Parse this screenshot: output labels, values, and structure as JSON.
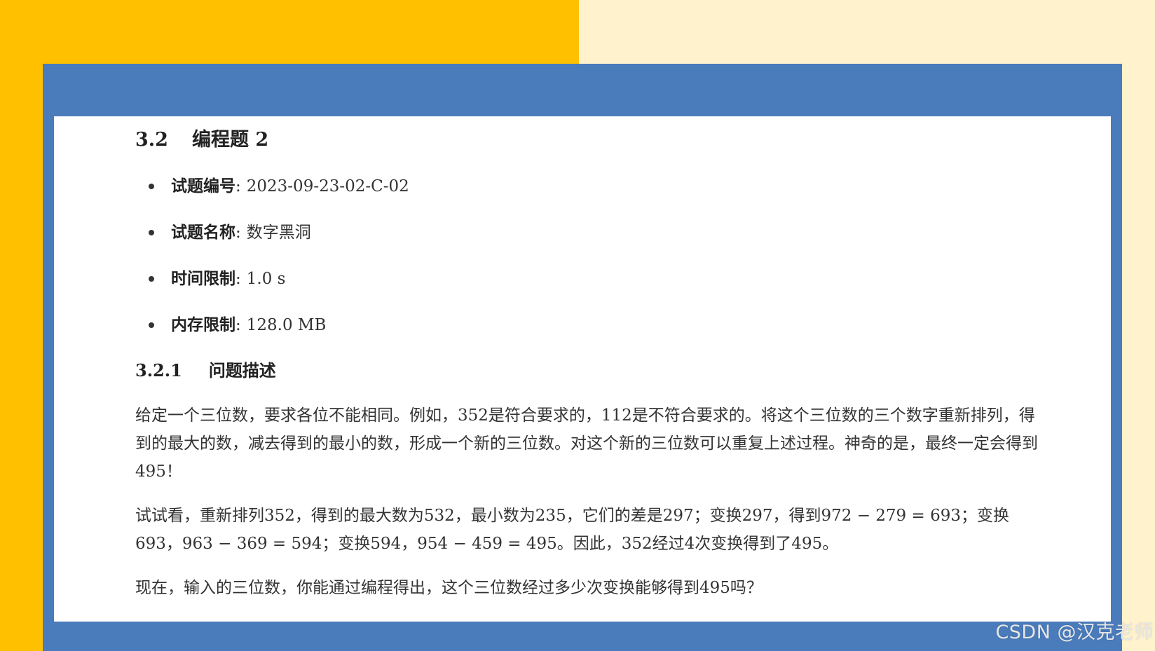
{
  "colors": {
    "background_left": "#ffc000",
    "background_right": "#fff2cc",
    "frame": "#4a7bbb",
    "panel": "#ffffff"
  },
  "section": {
    "number": "3.2",
    "title": "编程题 2"
  },
  "meta": [
    {
      "label": "试题编号",
      "colon": ":",
      "value": "2023-09-23-02-C-02"
    },
    {
      "label": "试题名称",
      "colon": ":",
      "value": "数字黑洞"
    },
    {
      "label": "时间限制",
      "colon": ":",
      "value": "1.0 s"
    },
    {
      "label": "内存限制",
      "colon": ":",
      "value": "128.0 MB"
    }
  ],
  "subsection": {
    "number": "3.2.1",
    "title": "问题描述"
  },
  "paragraphs": [
    "给定一个三位数，要求各位不能相同。例如，352是符合要求的，112是不符合要求的。将这个三位数的三个数字重新排列，得到的最大的数，减去得到的最小的数，形成一个新的三位数。对这个新的三位数可以重复上述过程。神奇的是，最终一定会得到495！",
    "试试看，重新排列352，得到的最大数为532，最小数为235，它们的差是297；变换297，得到972 − 279 = 693；变换693，963 − 369 = 594；变换594，954 − 459 = 495。因此，352经过4次变换得到了495。",
    "现在，输入的三位数，你能通过编程得出，这个三位数经过多少次变换能够得到495吗？"
  ],
  "watermark": "CSDN @汉克老师"
}
